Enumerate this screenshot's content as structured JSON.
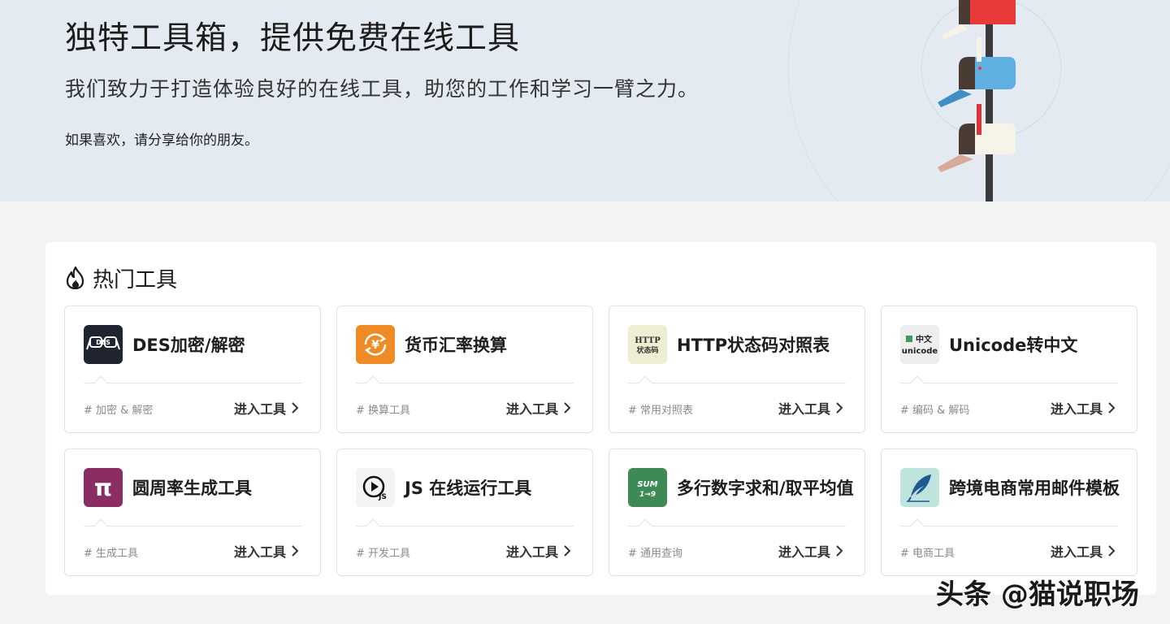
{
  "hero": {
    "title": "独特工具箱，提供免费在线工具",
    "subtitle": "我们致力于打造体验良好的在线工具，助您的工作和学习一臂之力。",
    "share_text": "如果喜欢，请分享给你的朋友。"
  },
  "section": {
    "icon": "flame-icon",
    "title": "热门工具"
  },
  "enter_label": "进入工具",
  "tools": [
    {
      "name": "DES加密/解密",
      "tag": "# 加密 & 解密",
      "icon": "glasses-des-icon",
      "icon_bg": "#1f2430",
      "icon_text": "DES"
    },
    {
      "name": "货币汇率换算",
      "tag": "# 换算工具",
      "icon": "currency-exchange-icon",
      "icon_bg": "#f08a24",
      "icon_text": "¥"
    },
    {
      "name": "HTTP状态码对照表",
      "tag": "# 常用对照表",
      "icon": "http-status-icon",
      "icon_bg": "#eeeed2",
      "icon_text": "HTTP",
      "icon_text2": "状态码"
    },
    {
      "name": "Unicode转中文",
      "tag": "# 编码 & 解码",
      "icon": "unicode-icon",
      "icon_bg": "#eeeeee",
      "icon_text": "中文",
      "icon_text2": "unicode"
    },
    {
      "name": "圆周率生成工具",
      "tag": "# 生成工具",
      "icon": "pi-icon",
      "icon_bg": "#8a2d63",
      "icon_text": "π"
    },
    {
      "name": "JS 在线运行工具",
      "tag": "# 开发工具",
      "icon": "play-js-icon",
      "icon_bg": "#f4f4f4",
      "icon_text": "JS"
    },
    {
      "name": "多行数字求和/取平均值",
      "tag": "# 通用查询",
      "icon": "sum-icon",
      "icon_bg": "#3e8a57",
      "icon_text": "SUM",
      "icon_text2": "1→9"
    },
    {
      "name": "跨境电商常用邮件模板",
      "tag": "# 电商工具",
      "icon": "quill-pen-icon",
      "icon_bg": "#bfe3dd",
      "icon_text": ""
    }
  ],
  "watermark": "头条 @猫说职场",
  "colors": {
    "hero_bg": "#e4eaf1",
    "page_bg": "#f2f4f2",
    "mailbox_red": "#e8393b",
    "mailbox_blue": "#5fb0e0",
    "mailbox_cream": "#f6f3e8"
  }
}
